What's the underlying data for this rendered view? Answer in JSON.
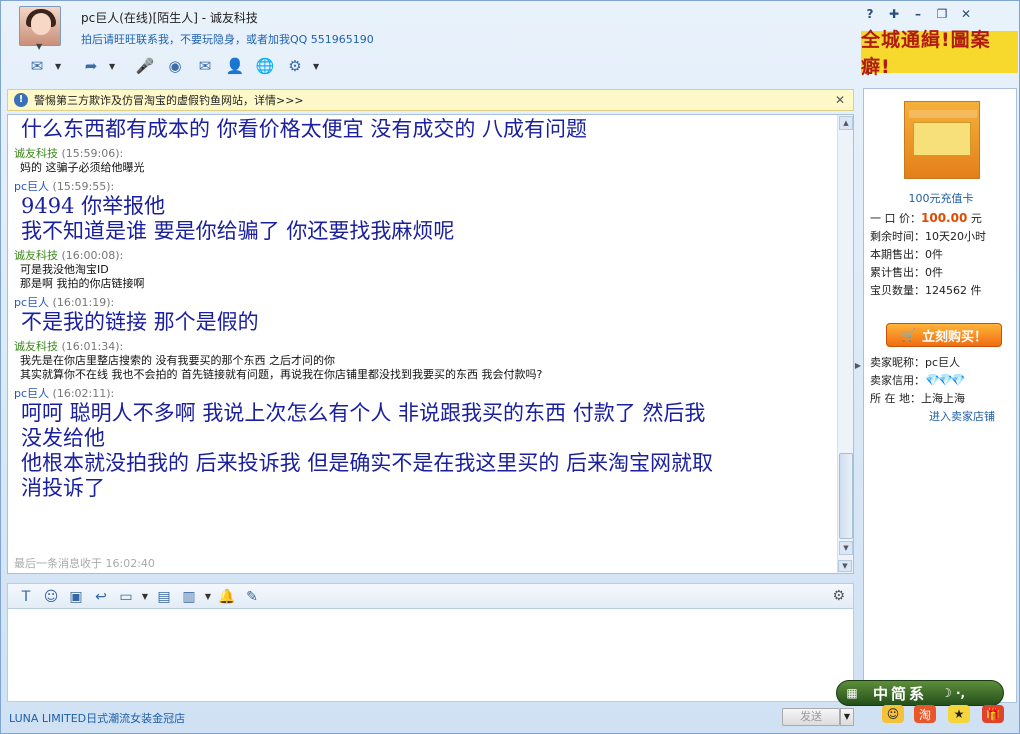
{
  "title": {
    "name_line": "pc巨人(在线)[陌生人] - 诚友科技",
    "signature": "拍后请旺旺联系我，不要玩隐身，或者加我QQ 551965190"
  },
  "notice": {
    "text": "警惕第三方欺诈及仿冒淘宝的虚假钓鱼网站，详情>>>"
  },
  "chat": {
    "messages": [
      {
        "lines": [
          "什么东西都有成本的 你看价格太便宜 没有成交的 八成有问题"
        ]
      },
      {
        "sender": "诚友科技",
        "time": "(15:59:06):",
        "small": [
          "妈的  这骗子必须给他曝光"
        ]
      },
      {
        "sender": "pc巨人",
        "time": "(15:59:55):",
        "lines": [
          "9494  你举报他",
          "我不知道是谁 要是你给骗了 你还要找我麻烦呢"
        ]
      },
      {
        "sender": "诚友科技",
        "time": "(16:00:08):",
        "small": [
          "可是我没他淘宝ID",
          "那是啊 我拍的你店链接啊"
        ]
      },
      {
        "sender": "pc巨人",
        "time": "(16:01:19):",
        "lines": [
          "不是我的链接 那个是假的"
        ]
      },
      {
        "sender": "诚友科技",
        "time": "(16:01:34):",
        "small": [
          "我先是在你店里整店搜索的  没有我要买的那个东西 之后才问的你",
          "其实就算你不在线  我也不会拍的  首先链接就有问题，再说我在你店铺里都没找到我要买的东西 我会付款吗?"
        ]
      },
      {
        "sender": "pc巨人",
        "time": "(16:02:11):",
        "lines": [
          "呵呵 聪明人不多啊 我说上次怎么有个人 非说跟我买的东西 付款了 然后我",
          "没发给他",
          "他根本就没拍我的 后来投诉我 但是确实不是在我这里买的 后来淘宝网就取",
          "消投诉了"
        ]
      }
    ],
    "last_message": "最后一条消息收于 16:02:40"
  },
  "bottom": {
    "shop_name": "LUNA LIMITED日式潮流女装金冠店",
    "send_label": "发送"
  },
  "banner": {
    "text": "全城通緝!圖案癖!"
  },
  "product": {
    "name": "100元充值卡",
    "price_label": "一 口 价：",
    "price_value": "100.00",
    "price_unit": "元",
    "remaining_label": "剩余时间：",
    "remaining_value": "10天20小时",
    "period_sold_label": "本期售出：",
    "period_sold_value": "0件",
    "total_sold_label": "累计售出：",
    "total_sold_value": "0件",
    "stock_label": "宝贝数量：",
    "stock_value": "124562 件",
    "buy_label": "立刻购买！"
  },
  "seller": {
    "nick_label": "卖家昵称：",
    "nick_value": "pc巨人",
    "credit_label": "卖家信用：",
    "location_label": "所 在 地：",
    "location_value": "上海上海",
    "enter_shop": "进入卖家店铺"
  },
  "ime": {
    "text": "中简系"
  },
  "colors": {
    "sender_self": "#3d8a1d",
    "sender_other": "#2455c2",
    "big_text": "#1a1f9e",
    "price": "#e04a00"
  }
}
